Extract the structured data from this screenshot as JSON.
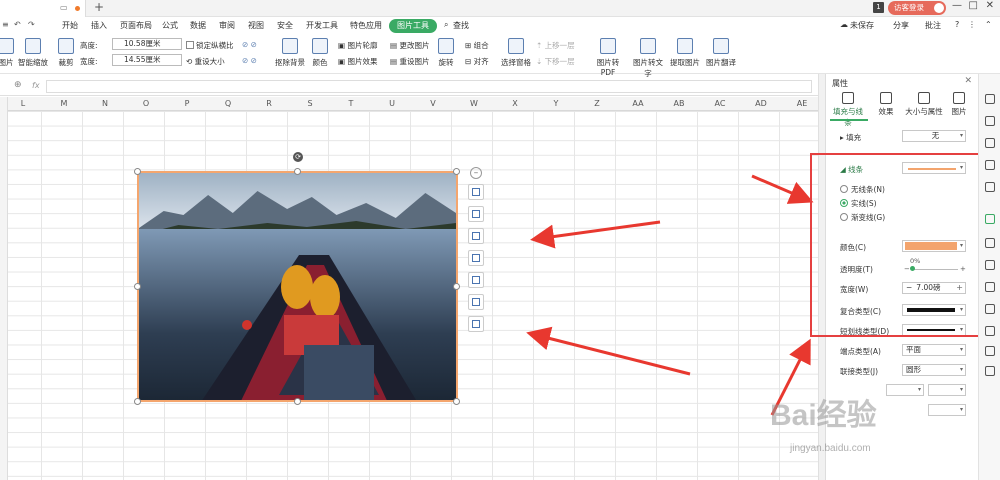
{
  "titlebar": {
    "add_tab": "+",
    "badge": "1",
    "visitor_label": "访客登录",
    "win_min": "—",
    "win_max": "□",
    "win_close": "✕"
  },
  "menu": {
    "items": [
      "开始",
      "插入",
      "页面布局",
      "公式",
      "数据",
      "审阅",
      "视图",
      "安全",
      "开发工具",
      "特色应用"
    ],
    "active": "图片工具",
    "search": "查找",
    "unsaved": "未保存",
    "share": "分享",
    "comment": "批注"
  },
  "ribbon": {
    "picture": "图片",
    "smart_zoom": "智能缩放",
    "crop": "裁剪",
    "height_label": "高度:",
    "height_value": "10.58厘米",
    "width_label": "宽度:",
    "width_value": "14.55厘米",
    "lock_ratio": "锁定纵横比",
    "reset_size": "重设大小",
    "remove_bg": "抠除背景",
    "color": "颜色",
    "outline": "图片轮廓",
    "effect": "图片效果",
    "change_pic": "更改图片",
    "reset_pic": "重设图片",
    "rotate": "旋转",
    "combine": "组合",
    "align": "对齐",
    "selection_pane": "选择窗格",
    "bring_forward": "上移一层",
    "send_backward": "下移一层",
    "to_pdf": "图片转PDF",
    "to_text": "图片转文字",
    "extract": "提取图片",
    "translate": "图片翻译"
  },
  "formula": {
    "fx": "fx"
  },
  "columns": [
    "L",
    "M",
    "N",
    "O",
    "P",
    "Q",
    "R",
    "S",
    "T",
    "U",
    "V",
    "W",
    "X",
    "Y",
    "Z",
    "AA",
    "AB",
    "AC",
    "AD",
    "AE"
  ],
  "panel": {
    "title": "属性",
    "tabs": [
      "填充与线条",
      "效果",
      "大小与属性",
      "图片"
    ],
    "fill_label": "填充",
    "fill_value": "无",
    "line_label": "线条",
    "radio_none": "无线条(N)",
    "radio_solid": "实线(S)",
    "radio_gradient": "渐变线(G)",
    "color_label": "颜色(C)",
    "line_color": "#f3a46d",
    "transparency_label": "透明度(T)",
    "transparency_value": "0%",
    "width_label": "宽度(W)",
    "width_value": "7.00磅",
    "compound_label": "复合类型(C)",
    "dash_label": "短划线类型(D)",
    "cap_label": "端点类型(A)",
    "cap_value": "平面",
    "join_label": "联接类型(J)",
    "join_value": "圆形"
  },
  "watermark": {
    "main": "Bai经验",
    "sub": "jingyan.baidu.com"
  }
}
